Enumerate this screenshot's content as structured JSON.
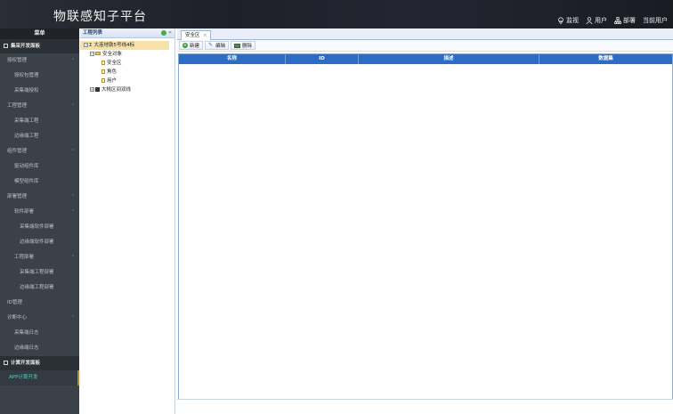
{
  "header": {
    "title": "物联感知子平台",
    "nav": [
      {
        "label": "监视",
        "icon": "location-pin-icon"
      },
      {
        "label": "用户",
        "icon": "user-icon"
      },
      {
        "label": "部署",
        "icon": "org-chart-icon"
      },
      {
        "label": "当前用户",
        "icon": ""
      }
    ]
  },
  "sidebar": {
    "heading": "菜单",
    "sections": [
      {
        "label": "集采开发面板",
        "type": "category"
      },
      {
        "label": "授权管理",
        "type": "l1",
        "expandable": true
      },
      {
        "label": "授权包管理",
        "type": "l2"
      },
      {
        "label": "采集端授权",
        "type": "l2"
      },
      {
        "label": "工程管理",
        "type": "l1",
        "expandable": true
      },
      {
        "label": "采集端工程",
        "type": "l2"
      },
      {
        "label": "边缘端工程",
        "type": "l2"
      },
      {
        "label": "组件管理",
        "type": "l1",
        "expandable": true
      },
      {
        "label": "驱动组件库",
        "type": "l2"
      },
      {
        "label": "模型组件库",
        "type": "l2"
      },
      {
        "label": "部署管理",
        "type": "l1",
        "expandable": true
      },
      {
        "label": "软件部署",
        "type": "l2",
        "expandable": true
      },
      {
        "label": "采集端软件部署",
        "type": "l3"
      },
      {
        "label": "边缘端软件部署",
        "type": "l3"
      },
      {
        "label": "工程部署",
        "type": "l2",
        "expandable": true
      },
      {
        "label": "采集端工程部署",
        "type": "l3"
      },
      {
        "label": "边缘端工程部署",
        "type": "l3"
      },
      {
        "label": "ID管理",
        "type": "l1"
      },
      {
        "label": "诊断中心",
        "type": "l1",
        "expandable": true
      },
      {
        "label": "采集端日志",
        "type": "l2"
      },
      {
        "label": "边缘端日志",
        "type": "l2"
      },
      {
        "label": "计算开发面板",
        "type": "category"
      },
      {
        "label": "APP计算开发",
        "type": "active"
      }
    ]
  },
  "tree": {
    "heading": "工程列表",
    "nodes": [
      {
        "label": "大连地铁5号线4标",
        "level": 0,
        "kind": "root",
        "toggle": "⊟",
        "selected": true
      },
      {
        "label": "安全对象",
        "level": 1,
        "kind": "folder",
        "toggle": "⊟"
      },
      {
        "label": "安全区",
        "level": 2,
        "kind": "leaf"
      },
      {
        "label": "角色",
        "level": 2,
        "kind": "leaf"
      },
      {
        "label": "用户",
        "level": 2,
        "kind": "leaf"
      },
      {
        "label": "大桃区间双线",
        "level": 1,
        "kind": "project",
        "toggle": "⊞"
      }
    ]
  },
  "main": {
    "tab_label": "安全区",
    "tab_close": "×",
    "toolbar": {
      "new_label": "新建",
      "edit_label": "编辑",
      "delete_label": "删除"
    },
    "columns": [
      "名称",
      "ID",
      "描述",
      "数据集"
    ]
  }
}
